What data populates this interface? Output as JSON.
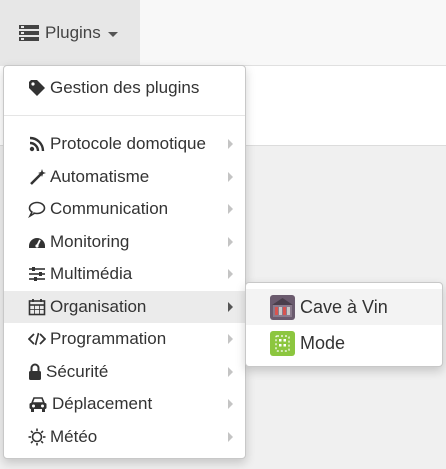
{
  "navbar": {
    "plugins_label": "Plugins",
    "plugins_icon": "plugin-list-icon"
  },
  "menu": {
    "header_item": {
      "label": "Gestion des plugins",
      "icon": "tag-icon"
    },
    "categories": [
      {
        "label": "Protocole domotique",
        "icon": "rss-icon"
      },
      {
        "label": "Automatisme",
        "icon": "magic-wand-icon"
      },
      {
        "label": "Communication",
        "icon": "speech-bubble-icon"
      },
      {
        "label": "Monitoring",
        "icon": "dashboard-gauge-icon"
      },
      {
        "label": "Multimédia",
        "icon": "sliders-icon"
      },
      {
        "label": "Organisation",
        "icon": "calendar-icon",
        "active": true
      },
      {
        "label": "Programmation",
        "icon": "code-icon"
      },
      {
        "label": "Sécurité",
        "icon": "lock-icon"
      },
      {
        "label": "Déplacement",
        "icon": "car-icon"
      },
      {
        "label": "Météo",
        "icon": "sun-icon"
      }
    ]
  },
  "submenu": {
    "items": [
      {
        "label": "Cave à Vin",
        "icon": "wine-cellar-icon",
        "icon_color": "#6b5b6e"
      },
      {
        "label": "Mode",
        "icon": "mode-icon",
        "icon_color": "#8cc63f"
      }
    ]
  },
  "colors": {
    "active_background": "#ebebeb",
    "navbar_active": "#e7e7e7",
    "mode_icon_green": "#8cc63f"
  }
}
